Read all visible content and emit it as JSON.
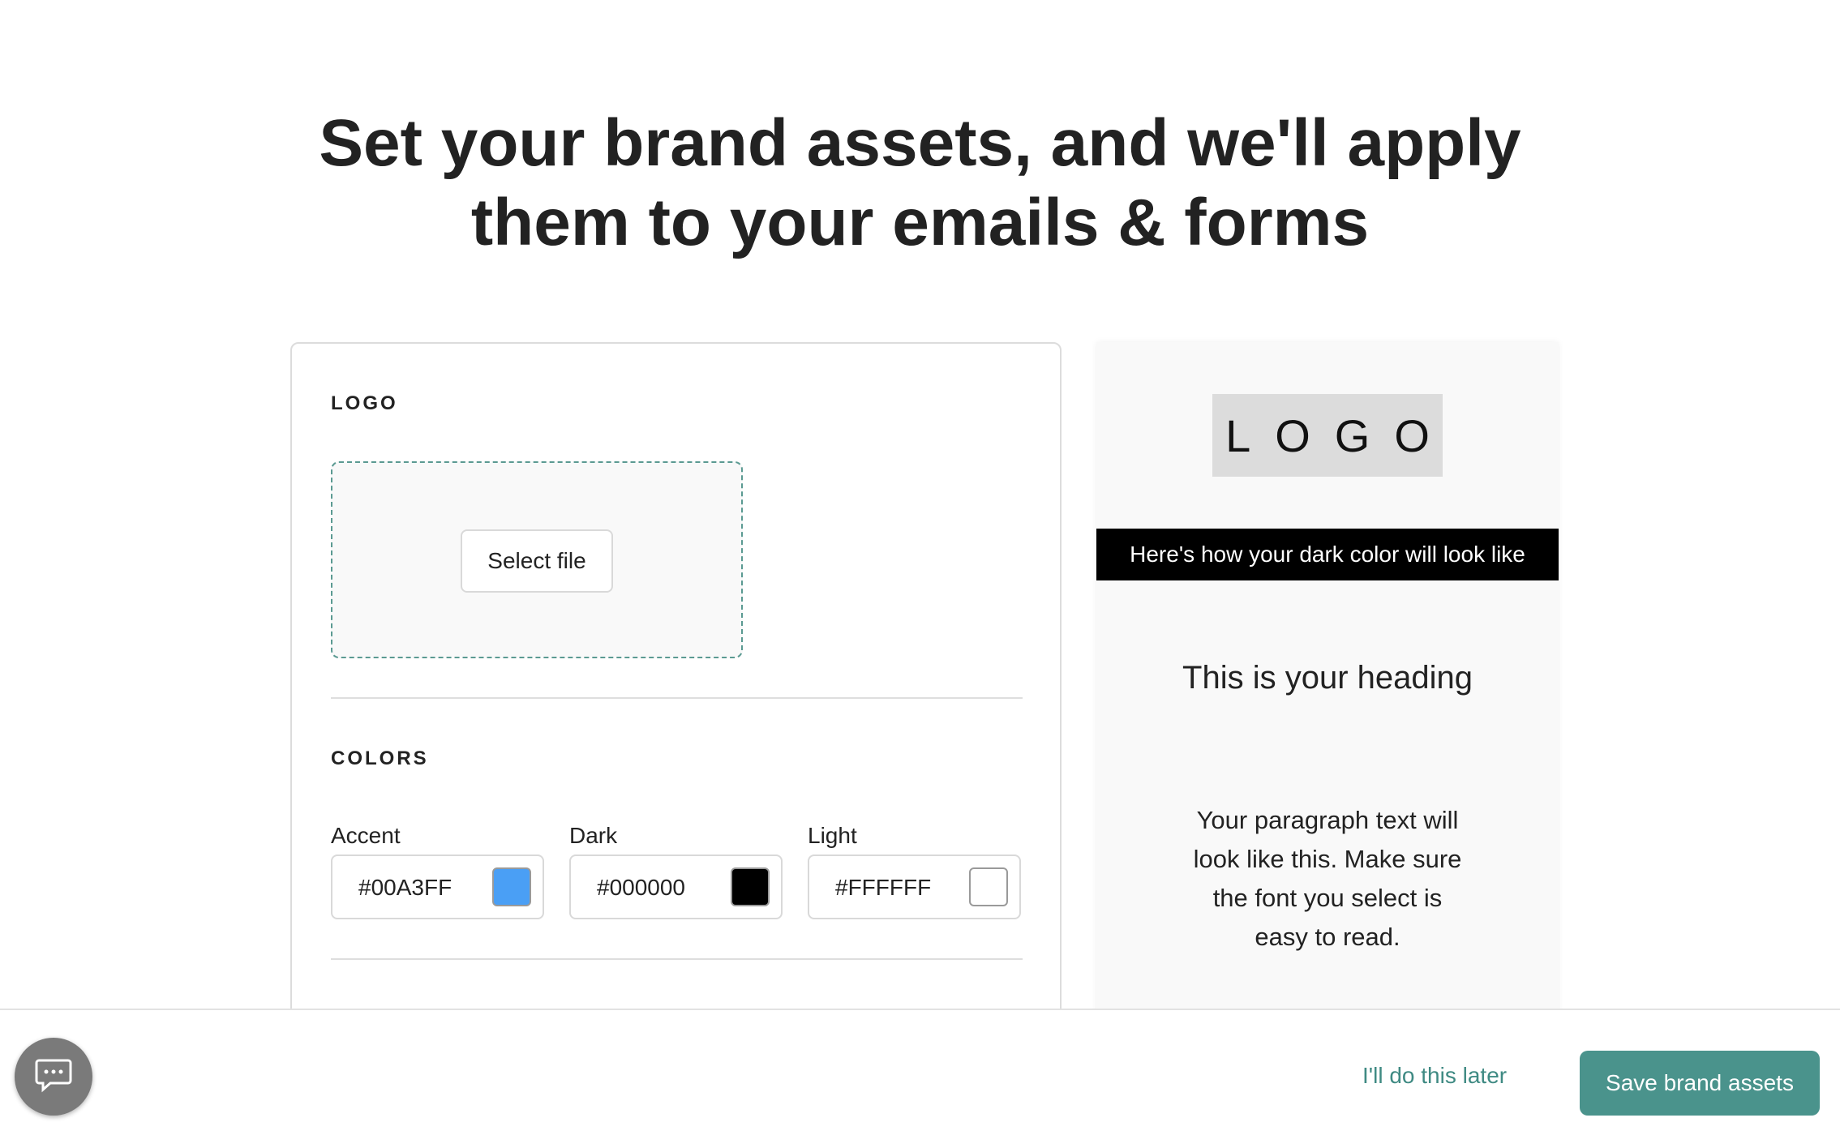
{
  "headline": {
    "line1": "Set your brand assets, and we'll apply",
    "line2": "them to your emails & forms"
  },
  "logo_section": {
    "label": "LOGO",
    "select_file_label": "Select file"
  },
  "colors_section": {
    "label": "COLORS",
    "fields": [
      {
        "label": "Accent",
        "value": "#00A3FF",
        "swatch_color": "#4A9FF5"
      },
      {
        "label": "Dark",
        "value": "#000000",
        "swatch_color": "#000000"
      },
      {
        "label": "Light",
        "value": "#FFFFFF",
        "swatch_color": "#FFFFFF"
      }
    ]
  },
  "preview": {
    "logo_text": "LOGO",
    "dark_bar_text": "Here's how your dark color will look like",
    "heading": "This is your heading",
    "paragraph": "Your paragraph text will look like this. Make sure the font you select is easy to read."
  },
  "footer": {
    "later_label": "I'll do this later",
    "save_label": "Save brand assets",
    "chat_icon": "chat-bubble-icon"
  },
  "colors": {
    "brand_teal": "#4A938C",
    "link_teal": "#3F8A83",
    "dropzone_border": "#5B9A92"
  }
}
